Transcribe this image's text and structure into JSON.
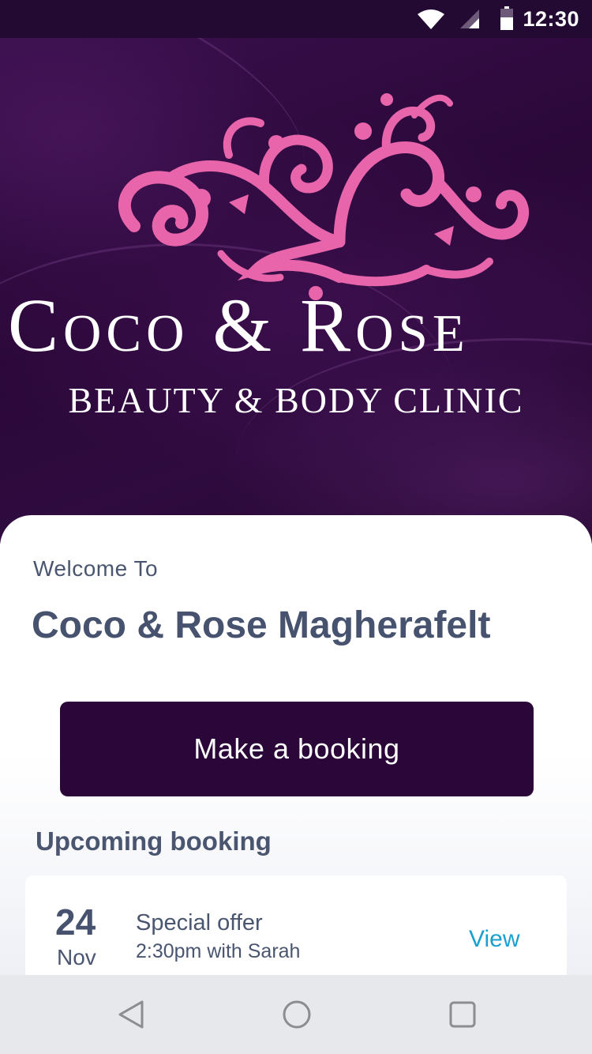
{
  "status_bar": {
    "time": "12:30",
    "icons": [
      "wifi-icon",
      "cell-signal-icon",
      "battery-icon"
    ]
  },
  "brand": {
    "name": "Coco & Rose",
    "tagline": "BEAUTY & BODY CLINIC",
    "ornament_color": "#e865ab"
  },
  "welcome": {
    "label": "Welcome To",
    "salon_name": "Coco & Rose Magherafelt"
  },
  "actions": {
    "make_booking": "Make a booking"
  },
  "upcoming": {
    "title": "Upcoming booking",
    "bookings": [
      {
        "day": "24",
        "month": "Nov",
        "service": "Special offer",
        "time_with": "2:30pm with Sarah",
        "action": "View"
      }
    ]
  },
  "nav": {
    "icons": [
      "back-icon",
      "home-icon",
      "recents-icon"
    ]
  },
  "colors": {
    "primary": "#2b0638",
    "link": "#1a9fd0",
    "text": "#4a5670",
    "accent_pink": "#e865ab"
  }
}
